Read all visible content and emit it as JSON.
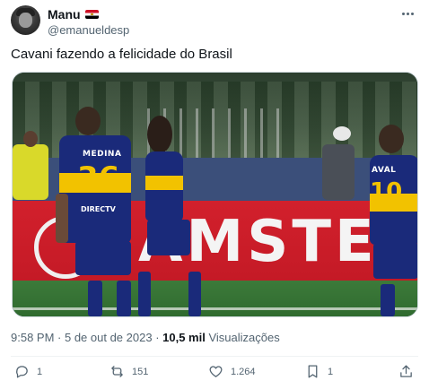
{
  "tweet": {
    "display_name": "Manu",
    "handle": "@emanueldesp",
    "text": "Cavani fazendo a felicidade do Brasil",
    "time": "9:58 PM",
    "separator": " · ",
    "date": "5 de out de 2023",
    "views_count": "10,5 mil",
    "views_label": " Visualizações"
  },
  "media": {
    "board_text": "AMSTE",
    "player1_name": "MEDINA",
    "player1_number": "36",
    "player1_sponsor": "DIRECTV",
    "player3_number": "10",
    "player3_name": "AVAL"
  },
  "actions": {
    "replies": "1",
    "retweets": "151",
    "likes": "1.264",
    "bookmarks": "1"
  },
  "icons": [
    "more-icon",
    "flag-icon",
    "reply-icon",
    "retweet-icon",
    "like-icon",
    "bookmark-icon",
    "share-icon"
  ]
}
